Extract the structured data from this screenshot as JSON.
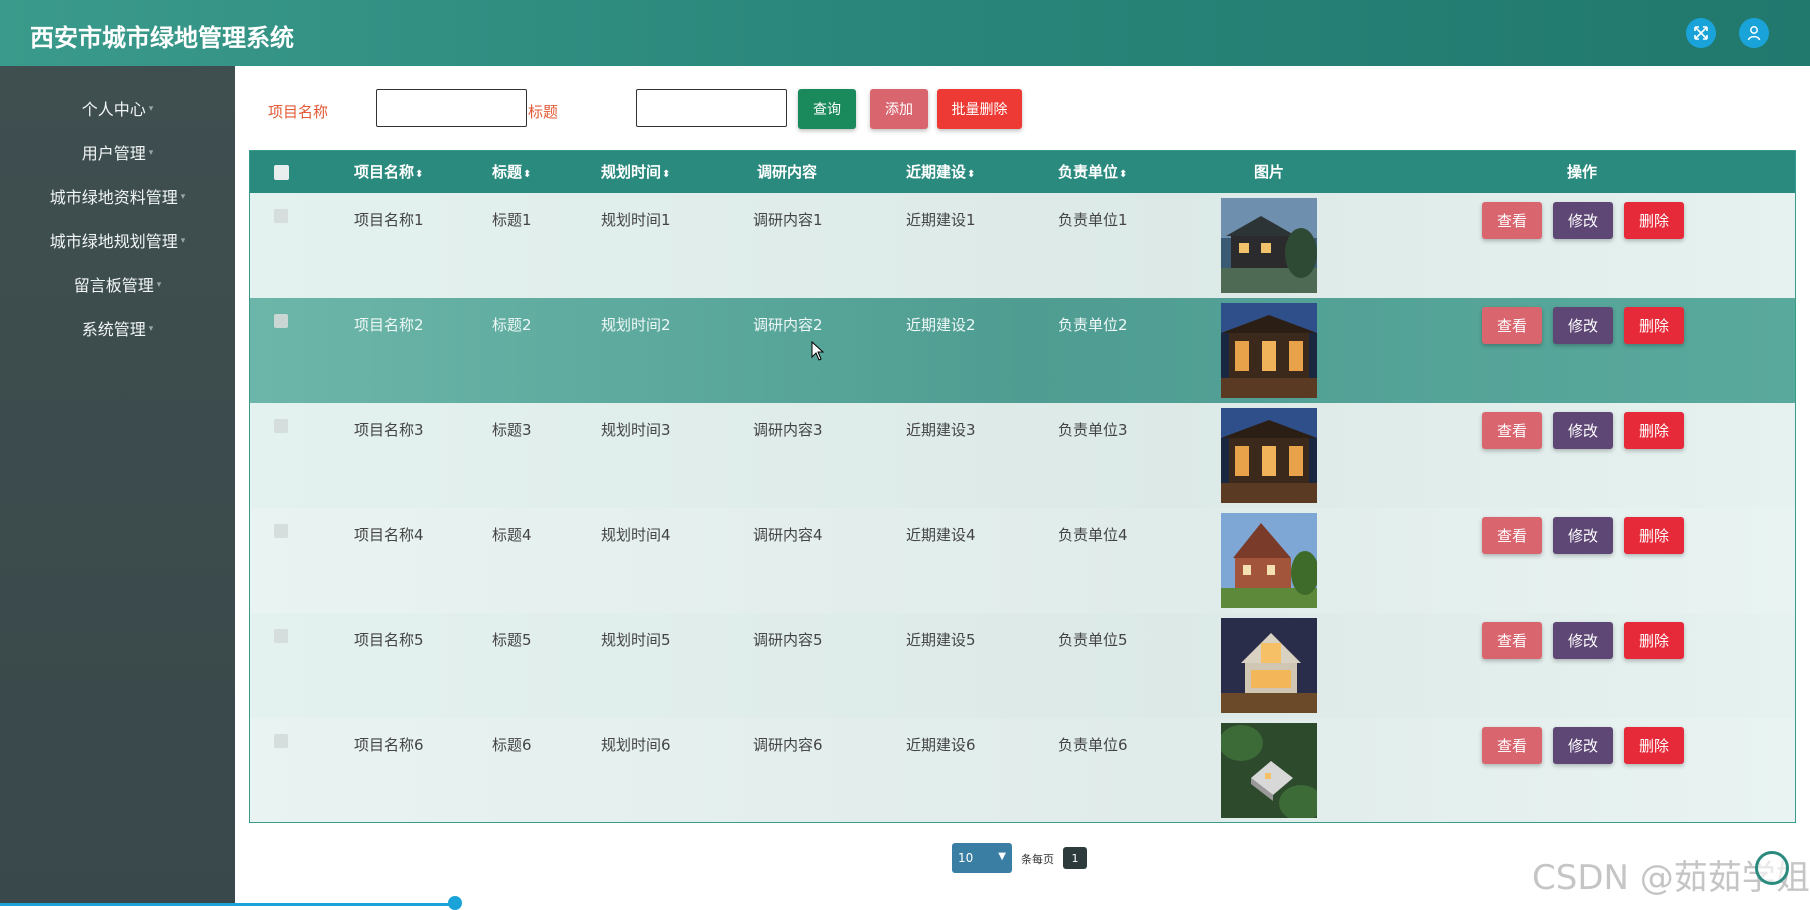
{
  "header": {
    "title": "西安市城市绿地管理系统",
    "fullscreen_icon": "fullscreen-icon",
    "user_icon": "user-icon"
  },
  "sidebar": {
    "items": [
      {
        "label": "个人中心"
      },
      {
        "label": "用户管理"
      },
      {
        "label": "城市绿地资料管理"
      },
      {
        "label": "城市绿地规划管理"
      },
      {
        "label": "留言板管理"
      },
      {
        "label": "系统管理"
      }
    ]
  },
  "search": {
    "project_label": "项目名称",
    "project_value": "",
    "title_label": "标题",
    "title_value": "",
    "query_label": "查询",
    "add_label": "添加",
    "batch_delete_label": "批量删除"
  },
  "table": {
    "columns": [
      "项目名称",
      "标题",
      "规划时间",
      "调研内容",
      "近期建设",
      "负责单位",
      "图片",
      "操作"
    ],
    "sort_glyph": "⬍",
    "rows": [
      {
        "project": "项目名称1",
        "title": "标题1",
        "plan_time": "规划时间1",
        "research": "调研内容1",
        "construction": "近期建设1",
        "unit": "负责单位1"
      },
      {
        "project": "项目名称2",
        "title": "标题2",
        "plan_time": "规划时间2",
        "research": "调研内容2",
        "construction": "近期建设2",
        "unit": "负责单位2"
      },
      {
        "project": "项目名称3",
        "title": "标题3",
        "plan_time": "规划时间3",
        "research": "调研内容3",
        "construction": "近期建设3",
        "unit": "负责单位3"
      },
      {
        "project": "项目名称4",
        "title": "标题4",
        "plan_time": "规划时间4",
        "research": "调研内容4",
        "construction": "近期建设4",
        "unit": "负责单位4"
      },
      {
        "project": "项目名称5",
        "title": "标题5",
        "plan_time": "规划时间5",
        "research": "调研内容5",
        "construction": "近期建设5",
        "unit": "负责单位5"
      },
      {
        "project": "项目名称6",
        "title": "标题6",
        "plan_time": "规划时间6",
        "research": "调研内容6",
        "construction": "近期建设6",
        "unit": "负责单位6"
      }
    ],
    "actions": {
      "view": "查看",
      "edit": "修改",
      "delete": "删除"
    }
  },
  "pagination": {
    "page_size": "10",
    "per_page_text": "条每页",
    "current_page": "1"
  },
  "watermark": "CSDN @茹茹学姐",
  "colors": {
    "header": "#2a877b",
    "sidebar": "#3f4f50",
    "accent": "#1aa3d8",
    "label": "#e25b36"
  }
}
